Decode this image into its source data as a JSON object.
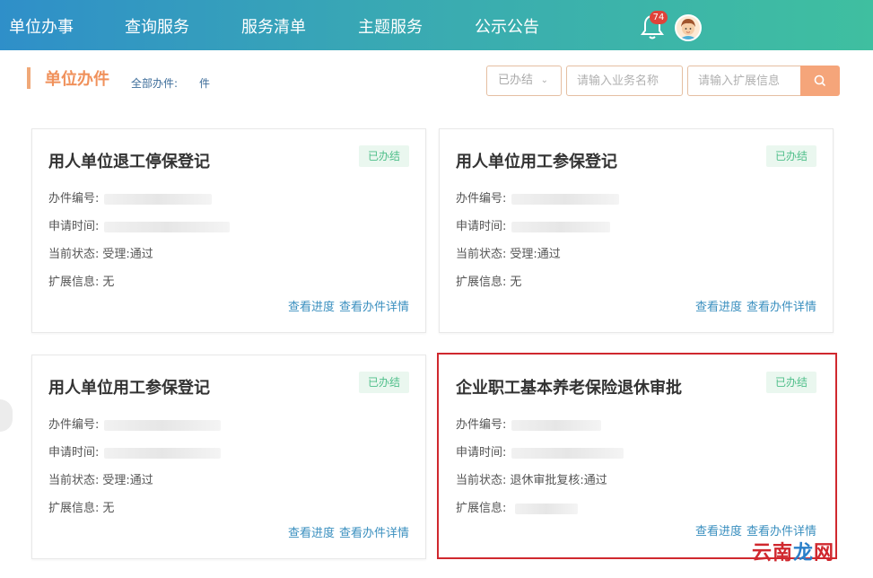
{
  "nav": {
    "items": [
      {
        "label": "单位办事"
      },
      {
        "label": "查询服务"
      },
      {
        "label": "服务清单"
      },
      {
        "label": "主题服务"
      },
      {
        "label": "公示公告"
      }
    ],
    "bell_icon": "bell-icon",
    "notification_count": "74",
    "avatar_icon": "user-avatar"
  },
  "header": {
    "title": "单位办件",
    "all_label": "全部办件:",
    "all_unit": "件"
  },
  "filters": {
    "status_value": "已办结",
    "business_name_placeholder": "请输入业务名称",
    "extended_info_placeholder": "请输入扩展信息",
    "search_icon": "search-icon"
  },
  "cards": [
    {
      "title": "用人单位退工停保登记",
      "badge": "已办结",
      "number_label": "办件编号:",
      "time_label": "申请时间:",
      "status_label": "当前状态:",
      "status_value": "受理:通过",
      "ext_label": "扩展信息:",
      "ext_value": "无",
      "progress_link": "查看进度",
      "detail_link": "查看办件详情"
    },
    {
      "title": "用人单位用工参保登记",
      "badge": "已办结",
      "number_label": "办件编号:",
      "time_label": "申请时间:",
      "status_label": "当前状态:",
      "status_value": "受理:通过",
      "ext_label": "扩展信息:",
      "ext_value": "无",
      "progress_link": "查看进度",
      "detail_link": "查看办件详情"
    },
    {
      "title": "用人单位用工参保登记",
      "badge": "已办结",
      "number_label": "办件编号:",
      "time_label": "申请时间:",
      "status_label": "当前状态:",
      "status_value": "受理:通过",
      "ext_label": "扩展信息:",
      "ext_value": "无",
      "progress_link": "查看进度",
      "detail_link": "查看办件详情"
    },
    {
      "title": "企业职工基本养老保险退休审批",
      "badge": "已办结",
      "number_label": "办件编号:",
      "time_label": "申请时间:",
      "status_label": "当前状态:",
      "status_value": "退休审批复核:通过",
      "ext_label": "扩展信息:",
      "ext_value": "",
      "progress_link": "查看进度",
      "detail_link": "查看办件详情"
    }
  ],
  "watermark": {
    "part1": "云南",
    "part2": "龙",
    "part3": "网"
  },
  "colors": {
    "accent": "#f0915b",
    "link": "#3a8fbf",
    "badge_text": "#4fbf8a",
    "highlight_border": "#d0282e"
  }
}
